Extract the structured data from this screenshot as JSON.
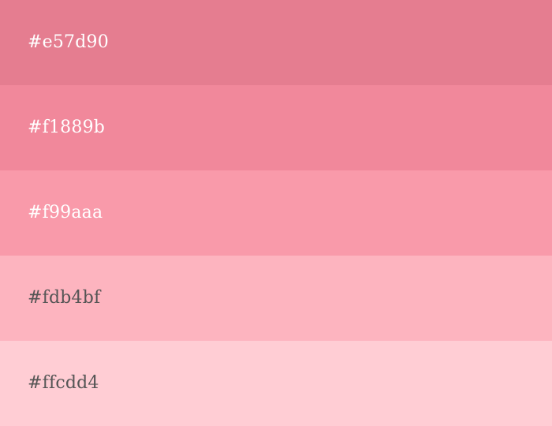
{
  "palette": {
    "swatches": [
      {
        "label": "#e57d90",
        "color": "#e57d90",
        "text_color": "#ffffff"
      },
      {
        "label": "#f1889b",
        "color": "#f1889b",
        "text_color": "#ffffff"
      },
      {
        "label": "#f99aaa",
        "color": "#f99aaa",
        "text_color": "#ffffff"
      },
      {
        "label": "#fdb4bf",
        "color": "#fdb4bf",
        "text_color": "#555555"
      },
      {
        "label": "#ffcdd4",
        "color": "#ffcdd4",
        "text_color": "#555555"
      }
    ]
  }
}
